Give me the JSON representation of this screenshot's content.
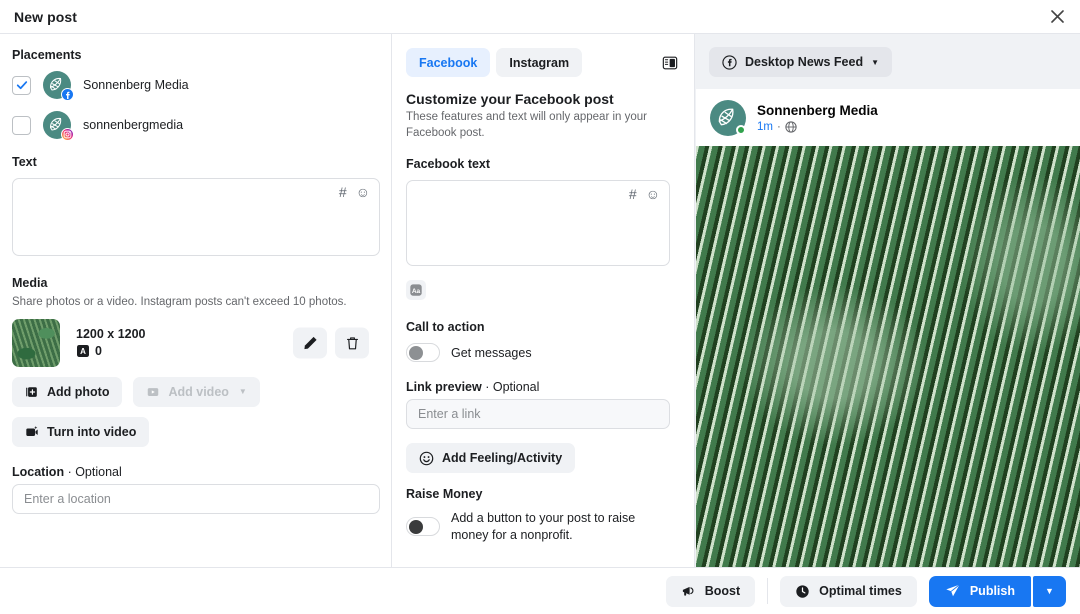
{
  "header": {
    "title": "New post",
    "close_icon": "close-icon"
  },
  "left": {
    "placements_title": "Placements",
    "placements": [
      {
        "name": "Sonnenberg Media",
        "platform": "facebook",
        "checked": true
      },
      {
        "name": "sonnenbergmedia",
        "platform": "instagram",
        "checked": false
      }
    ],
    "text_title": "Text",
    "text_value": "",
    "text_tools": {
      "hashtag": "#",
      "emoji": "☺"
    },
    "media_title": "Media",
    "media_desc": "Share photos or a video. Instagram posts can't exceed 10 photos.",
    "media_item": {
      "dimensions": "1200 x 1200",
      "alt_count": "0",
      "alt_icon": "alt-text-icon"
    },
    "media_actions": {
      "edit": "edit-pencil-icon",
      "delete": "trash-icon"
    },
    "add_photo_label": "Add photo",
    "add_video_label": "Add video",
    "turn_into_video_label": "Turn into video",
    "location_title": "Location",
    "location_optional": "· Optional",
    "location_placeholder": "Enter a location",
    "location_value": ""
  },
  "mid": {
    "tabs": [
      {
        "label": "Facebook",
        "active": true
      },
      {
        "label": "Instagram",
        "active": false
      }
    ],
    "split_view_icon": "split-view-icon",
    "heading": "Customize your Facebook post",
    "description": "These features and text will only appear in your Facebook post.",
    "fb_text_title": "Facebook text",
    "fb_text_value": "",
    "text_tools": {
      "hashtag": "#",
      "emoji": "☺"
    },
    "aa_icon_label": "Aa",
    "cta_title": "Call to action",
    "cta_toggle_label": "Get messages",
    "cta_toggle_on": false,
    "link_preview_title": "Link preview",
    "link_preview_optional": "· Optional",
    "link_placeholder": "Enter a link",
    "link_value": "",
    "feeling_label": "Add Feeling/Activity",
    "raise_money_title": "Raise Money",
    "raise_money_desc": "Add a button to your post to raise money for a nonprofit.",
    "raise_money_on": false
  },
  "preview": {
    "selector_label": "Desktop News Feed",
    "selector_icon": "facebook-icon",
    "account_name": "Sonnenberg Media",
    "timestamp": "1m",
    "separator": "·",
    "privacy_icon": "globe-icon"
  },
  "footer": {
    "boost_label": "Boost",
    "boost_icon": "megaphone-icon",
    "optimal_times_label": "Optimal times",
    "optimal_times_icon": "clock-icon",
    "publish_label": "Publish",
    "publish_icon": "send-icon",
    "publish_caret_icon": "chevron-down-icon"
  },
  "colors": {
    "accent_blue": "#1877f2",
    "tab_active_bg": "#e7f0fe",
    "panel_bg": "#f0f2f5",
    "brand_teal": "#4b8a82"
  }
}
